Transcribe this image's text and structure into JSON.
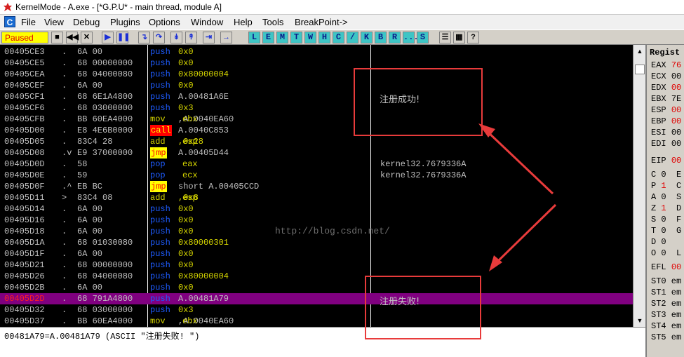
{
  "window": {
    "title": "KernelMode - A.exe - [*G.P.U* - main thread, module A]"
  },
  "menu": {
    "icon": "C",
    "items": [
      "File",
      "View",
      "Debug",
      "Plugins",
      "Options",
      "Window",
      "Help",
      "Tools",
      "BreakPoint->"
    ]
  },
  "toolbar": {
    "status": "Paused",
    "buttons": [
      "open-icon",
      "rewind-icon",
      "close-icon",
      "run-icon",
      "pause-icon",
      "step-into-icon",
      "step-over-icon",
      "trace-into-icon",
      "trace-over-icon",
      "execute-till-return-icon",
      "goto-icon"
    ],
    "letters": [
      "L",
      "E",
      "M",
      "T",
      "W",
      "H",
      "C",
      "/",
      "K",
      "B",
      "R",
      "...",
      "S"
    ],
    "right_buttons": [
      "list-icon",
      "grid-icon",
      "help-icon"
    ]
  },
  "disasm": [
    {
      "addr": "00405CE3",
      "mark": ".",
      "hex": "6A 00",
      "op": "push",
      "arg": [
        {
          "t": "num",
          "v": "0x0"
        }
      ],
      "comment": ""
    },
    {
      "addr": "00405CE5",
      "mark": ".",
      "hex": "68 00000000",
      "op": "push",
      "arg": [
        {
          "t": "num",
          "v": "0x0"
        }
      ],
      "comment": ""
    },
    {
      "addr": "00405CEA",
      "mark": ".",
      "hex": "68 04000080",
      "op": "push",
      "arg": [
        {
          "t": "num",
          "v": "0x80000004"
        }
      ],
      "comment": ""
    },
    {
      "addr": "00405CEF",
      "mark": ".",
      "hex": "6A 00",
      "op": "push",
      "arg": [
        {
          "t": "num",
          "v": "0x0"
        }
      ],
      "comment": ""
    },
    {
      "addr": "00405CF1",
      "mark": ".",
      "hex": "68 6E1A4800",
      "op": "push",
      "arg": [
        {
          "t": "txt",
          "v": "A.00481A6E"
        }
      ],
      "comment": ""
    },
    {
      "addr": "00405CF6",
      "mark": ".",
      "hex": "68 03000000",
      "op": "push",
      "arg": [
        {
          "t": "num",
          "v": "0x3"
        }
      ],
      "comment": ""
    },
    {
      "addr": "00405CFB",
      "mark": ".",
      "hex": "BB 60EA4000",
      "op": "mov",
      "arg": [
        {
          "t": "reg",
          "v": "ebx"
        },
        {
          "t": "txt",
          "v": ",A.0040EA60"
        }
      ],
      "comment": ""
    },
    {
      "addr": "00405D00",
      "mark": ".",
      "hex": "E8 4E6B0000",
      "op": "call",
      "arg": [
        {
          "t": "txt",
          "v": "A.0040C853"
        }
      ],
      "comment": ""
    },
    {
      "addr": "00405D05",
      "mark": ".",
      "hex": "83C4 28",
      "op": "add",
      "arg": [
        {
          "t": "reg",
          "v": "esp"
        },
        {
          "t": "num",
          "v": ",0x28"
        }
      ],
      "comment": ""
    },
    {
      "addr": "00405D08",
      "mark": ".v",
      "hex": "E9 37000000",
      "op": "jmp",
      "arg": [
        {
          "t": "txt",
          "v": "A.00405D44"
        }
      ],
      "comment": ""
    },
    {
      "addr": "00405D0D",
      "mark": ".",
      "hex": "58",
      "op": "pop",
      "arg": [
        {
          "t": "reg",
          "v": "eax"
        }
      ],
      "comment": "kernel32.7679336A"
    },
    {
      "addr": "00405D0E",
      "mark": ".",
      "hex": "59",
      "op": "pop",
      "arg": [
        {
          "t": "reg",
          "v": "ecx"
        }
      ],
      "comment": "kernel32.7679336A"
    },
    {
      "addr": "00405D0F",
      "mark": ".^",
      "hex": "EB BC",
      "op": "jmp",
      "arg": [
        {
          "t": "txt",
          "v": "short A.00405CCD"
        }
      ],
      "comment": ""
    },
    {
      "addr": "00405D11",
      "mark": ">",
      "hex": "83C4 08",
      "op": "add",
      "arg": [
        {
          "t": "reg",
          "v": "esp"
        },
        {
          "t": "num",
          "v": ",0x8"
        }
      ],
      "comment": ""
    },
    {
      "addr": "00405D14",
      "mark": ".",
      "hex": "6A 00",
      "op": "push",
      "arg": [
        {
          "t": "num",
          "v": "0x0"
        }
      ],
      "comment": ""
    },
    {
      "addr": "00405D16",
      "mark": ".",
      "hex": "6A 00",
      "op": "push",
      "arg": [
        {
          "t": "num",
          "v": "0x0"
        }
      ],
      "comment": ""
    },
    {
      "addr": "00405D18",
      "mark": ".",
      "hex": "6A 00",
      "op": "push",
      "arg": [
        {
          "t": "num",
          "v": "0x0"
        }
      ],
      "comment": ""
    },
    {
      "addr": "00405D1A",
      "mark": ".",
      "hex": "68 01030080",
      "op": "push",
      "arg": [
        {
          "t": "num",
          "v": "0x80000301"
        }
      ],
      "comment": ""
    },
    {
      "addr": "00405D1F",
      "mark": ".",
      "hex": "6A 00",
      "op": "push",
      "arg": [
        {
          "t": "num",
          "v": "0x0"
        }
      ],
      "comment": ""
    },
    {
      "addr": "00405D21",
      "mark": ".",
      "hex": "68 00000000",
      "op": "push",
      "arg": [
        {
          "t": "num",
          "v": "0x0"
        }
      ],
      "comment": ""
    },
    {
      "addr": "00405D26",
      "mark": ".",
      "hex": "68 04000080",
      "op": "push",
      "arg": [
        {
          "t": "num",
          "v": "0x80000004"
        }
      ],
      "comment": ""
    },
    {
      "addr": "00405D2B",
      "mark": ".",
      "hex": "6A 00",
      "op": "push",
      "arg": [
        {
          "t": "num",
          "v": "0x0"
        }
      ],
      "comment": ""
    },
    {
      "addr": "00405D2D",
      "mark": ".",
      "hex": "68 791A4800",
      "op": "push",
      "arg": [
        {
          "t": "txt",
          "v": "A.00481A79"
        }
      ],
      "comment": "",
      "selected": true
    },
    {
      "addr": "00405D32",
      "mark": ".",
      "hex": "68 03000000",
      "op": "push",
      "arg": [
        {
          "t": "num",
          "v": "0x3"
        }
      ],
      "comment": ""
    },
    {
      "addr": "00405D37",
      "mark": ".",
      "hex": "BB 60EA4000",
      "op": "mov",
      "arg": [
        {
          "t": "reg",
          "v": "ebx"
        },
        {
          "t": "txt",
          "v": ",A.0040EA60"
        }
      ],
      "comment": ""
    }
  ],
  "info_line": "00481A79=A.00481A79 (ASCII \"注册失败! \")",
  "annotations": {
    "success": "注册成功!",
    "fail": "注册失败!"
  },
  "watermark": "http://blog.csdn.net/",
  "registers": {
    "header": "Regist",
    "items": [
      {
        "name": "EAX",
        "val": "76",
        "red": true
      },
      {
        "name": "ECX",
        "val": "00",
        "red": false
      },
      {
        "name": "EDX",
        "val": "00",
        "red": true
      },
      {
        "name": "EBX",
        "val": "7E",
        "red": false
      },
      {
        "name": "ESP",
        "val": "00",
        "red": true
      },
      {
        "name": "EBP",
        "val": "00",
        "red": true
      },
      {
        "name": "ESI",
        "val": "00",
        "red": false
      },
      {
        "name": "EDI",
        "val": "00",
        "red": false
      },
      {
        "name": "EIP",
        "val": "00",
        "red": true
      }
    ],
    "flags": [
      {
        "name": "C",
        "num": "0",
        "val": "E",
        "red": false
      },
      {
        "name": "P",
        "num": "1",
        "val": "C",
        "red": true
      },
      {
        "name": "A",
        "num": "0",
        "val": "S",
        "red": false
      },
      {
        "name": "Z",
        "num": "1",
        "val": "D",
        "red": true
      },
      {
        "name": "S",
        "num": "0",
        "val": "F",
        "red": false
      },
      {
        "name": "T",
        "num": "0",
        "val": "G",
        "red": false
      },
      {
        "name": "D",
        "num": "0",
        "val": "",
        "red": false
      },
      {
        "name": "O",
        "num": "0",
        "val": "L",
        "red": false
      }
    ],
    "efl": {
      "name": "EFL",
      "val": "00"
    },
    "fpu": [
      "ST0 em",
      "ST1 em",
      "ST2 em",
      "ST3 em",
      "ST4 em",
      "ST5 em"
    ]
  }
}
